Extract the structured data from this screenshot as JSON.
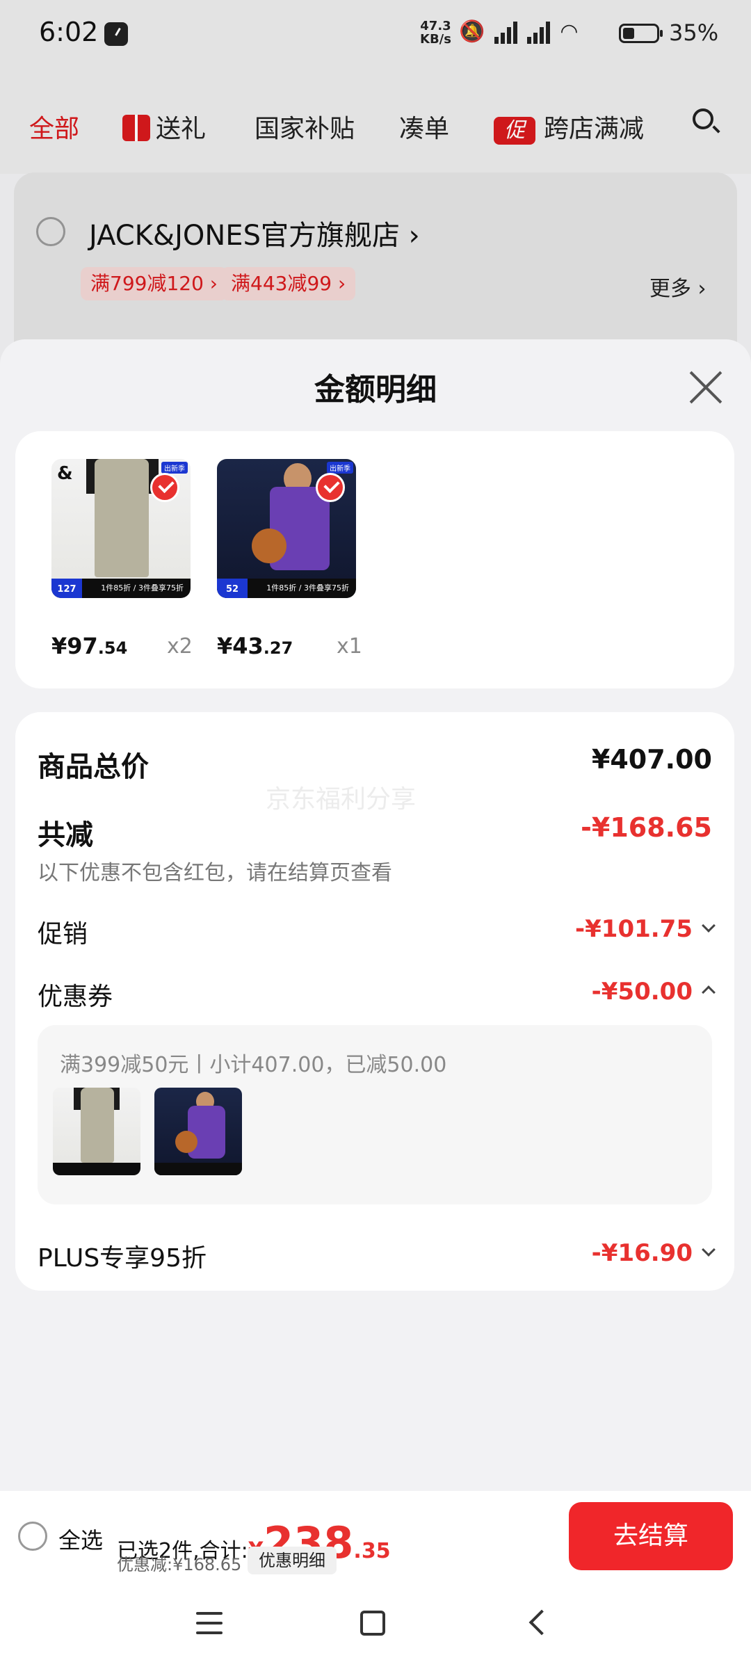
{
  "status_bar": {
    "time": "6:02",
    "net_speed_value": "47.3",
    "net_speed_unit": "KB/s",
    "battery": "35%"
  },
  "top_nav": {
    "tabs": [
      {
        "label": "全部"
      },
      {
        "label": "送礼",
        "icon": "gift-icon"
      },
      {
        "label": "国家补贴"
      },
      {
        "label": "凑单"
      },
      {
        "label": "跨店满减",
        "badge": "促"
      }
    ]
  },
  "store": {
    "name": "JACK&JONES官方旗舰店 ›",
    "coupons": [
      "满799减120 ›",
      "满443减99 ›"
    ],
    "more": "更多 ›"
  },
  "sheet": {
    "title": "金额明细",
    "items": [
      {
        "price_int": "¥97",
        "price_dec": ".54",
        "qty": "x2",
        "thumb_promo": "1件85折 / 3件叠享75折",
        "thumb_badge": "127",
        "thumb_tag": "出新季"
      },
      {
        "price_int": "¥43",
        "price_dec": ".27",
        "qty": "x1",
        "thumb_promo": "1件85折 / 3件叠享75折",
        "thumb_badge": "52",
        "thumb_tag": "出新季"
      }
    ],
    "watermark": "京东福利分享",
    "total_label": "商品总价",
    "total_value": "¥407.00",
    "reduce_label": "共减",
    "reduce_value": "-¥168.65",
    "reduce_note": "以下优惠不包含红包，请在结算页查看",
    "promo_label": "促销",
    "promo_value": "-¥101.75",
    "coupon_label": "优惠券",
    "coupon_value": "-¥50.00",
    "coupon_detail": "满399减50元丨小计407.00，已减50.00",
    "plus_label": "PLUS专享95折",
    "plus_value": "-¥16.90"
  },
  "checkout": {
    "select_all": "全选",
    "selected_text": "已选2件,合计:",
    "total_currency": "¥",
    "total_int": "238",
    "total_dec": ".35",
    "discount_text": "优惠减:¥168.65",
    "detail_button": "优惠明细",
    "checkout_button": "去结算"
  },
  "colors": {
    "accent": "#e8312f",
    "button": "#f0262a"
  }
}
